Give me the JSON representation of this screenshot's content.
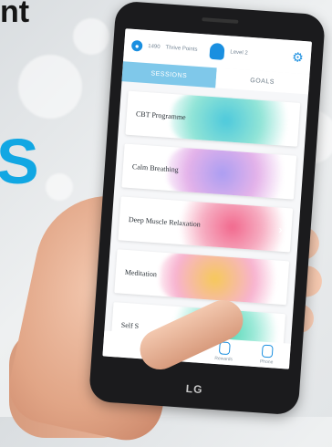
{
  "headline": {
    "fragment_top": "nt",
    "fragment_s": "S"
  },
  "app": {
    "coins": "1490",
    "points_label": "Thrive Points",
    "level": "Level 2",
    "tabs": [
      {
        "label": "SESSIONS",
        "active": true
      },
      {
        "label": "GOALS",
        "active": false
      }
    ],
    "sessions": [
      {
        "label": "CBT Programme",
        "splash_color": "#4cc9c0"
      },
      {
        "label": "Calm Breathing",
        "splash_color": "#b59bea"
      },
      {
        "label": "Deep Muscle Relaxation",
        "splash_color": "#f06a86"
      },
      {
        "label": "Meditation",
        "splash_color": "#f2c24e"
      },
      {
        "label": "Self S",
        "splash_color": "#4cd0b8"
      }
    ],
    "nav": [
      {
        "label": "Rewards",
        "icon": "rewards-icon"
      },
      {
        "label": "Phone",
        "icon": "phone-icon"
      }
    ]
  },
  "device_brand": "LG"
}
